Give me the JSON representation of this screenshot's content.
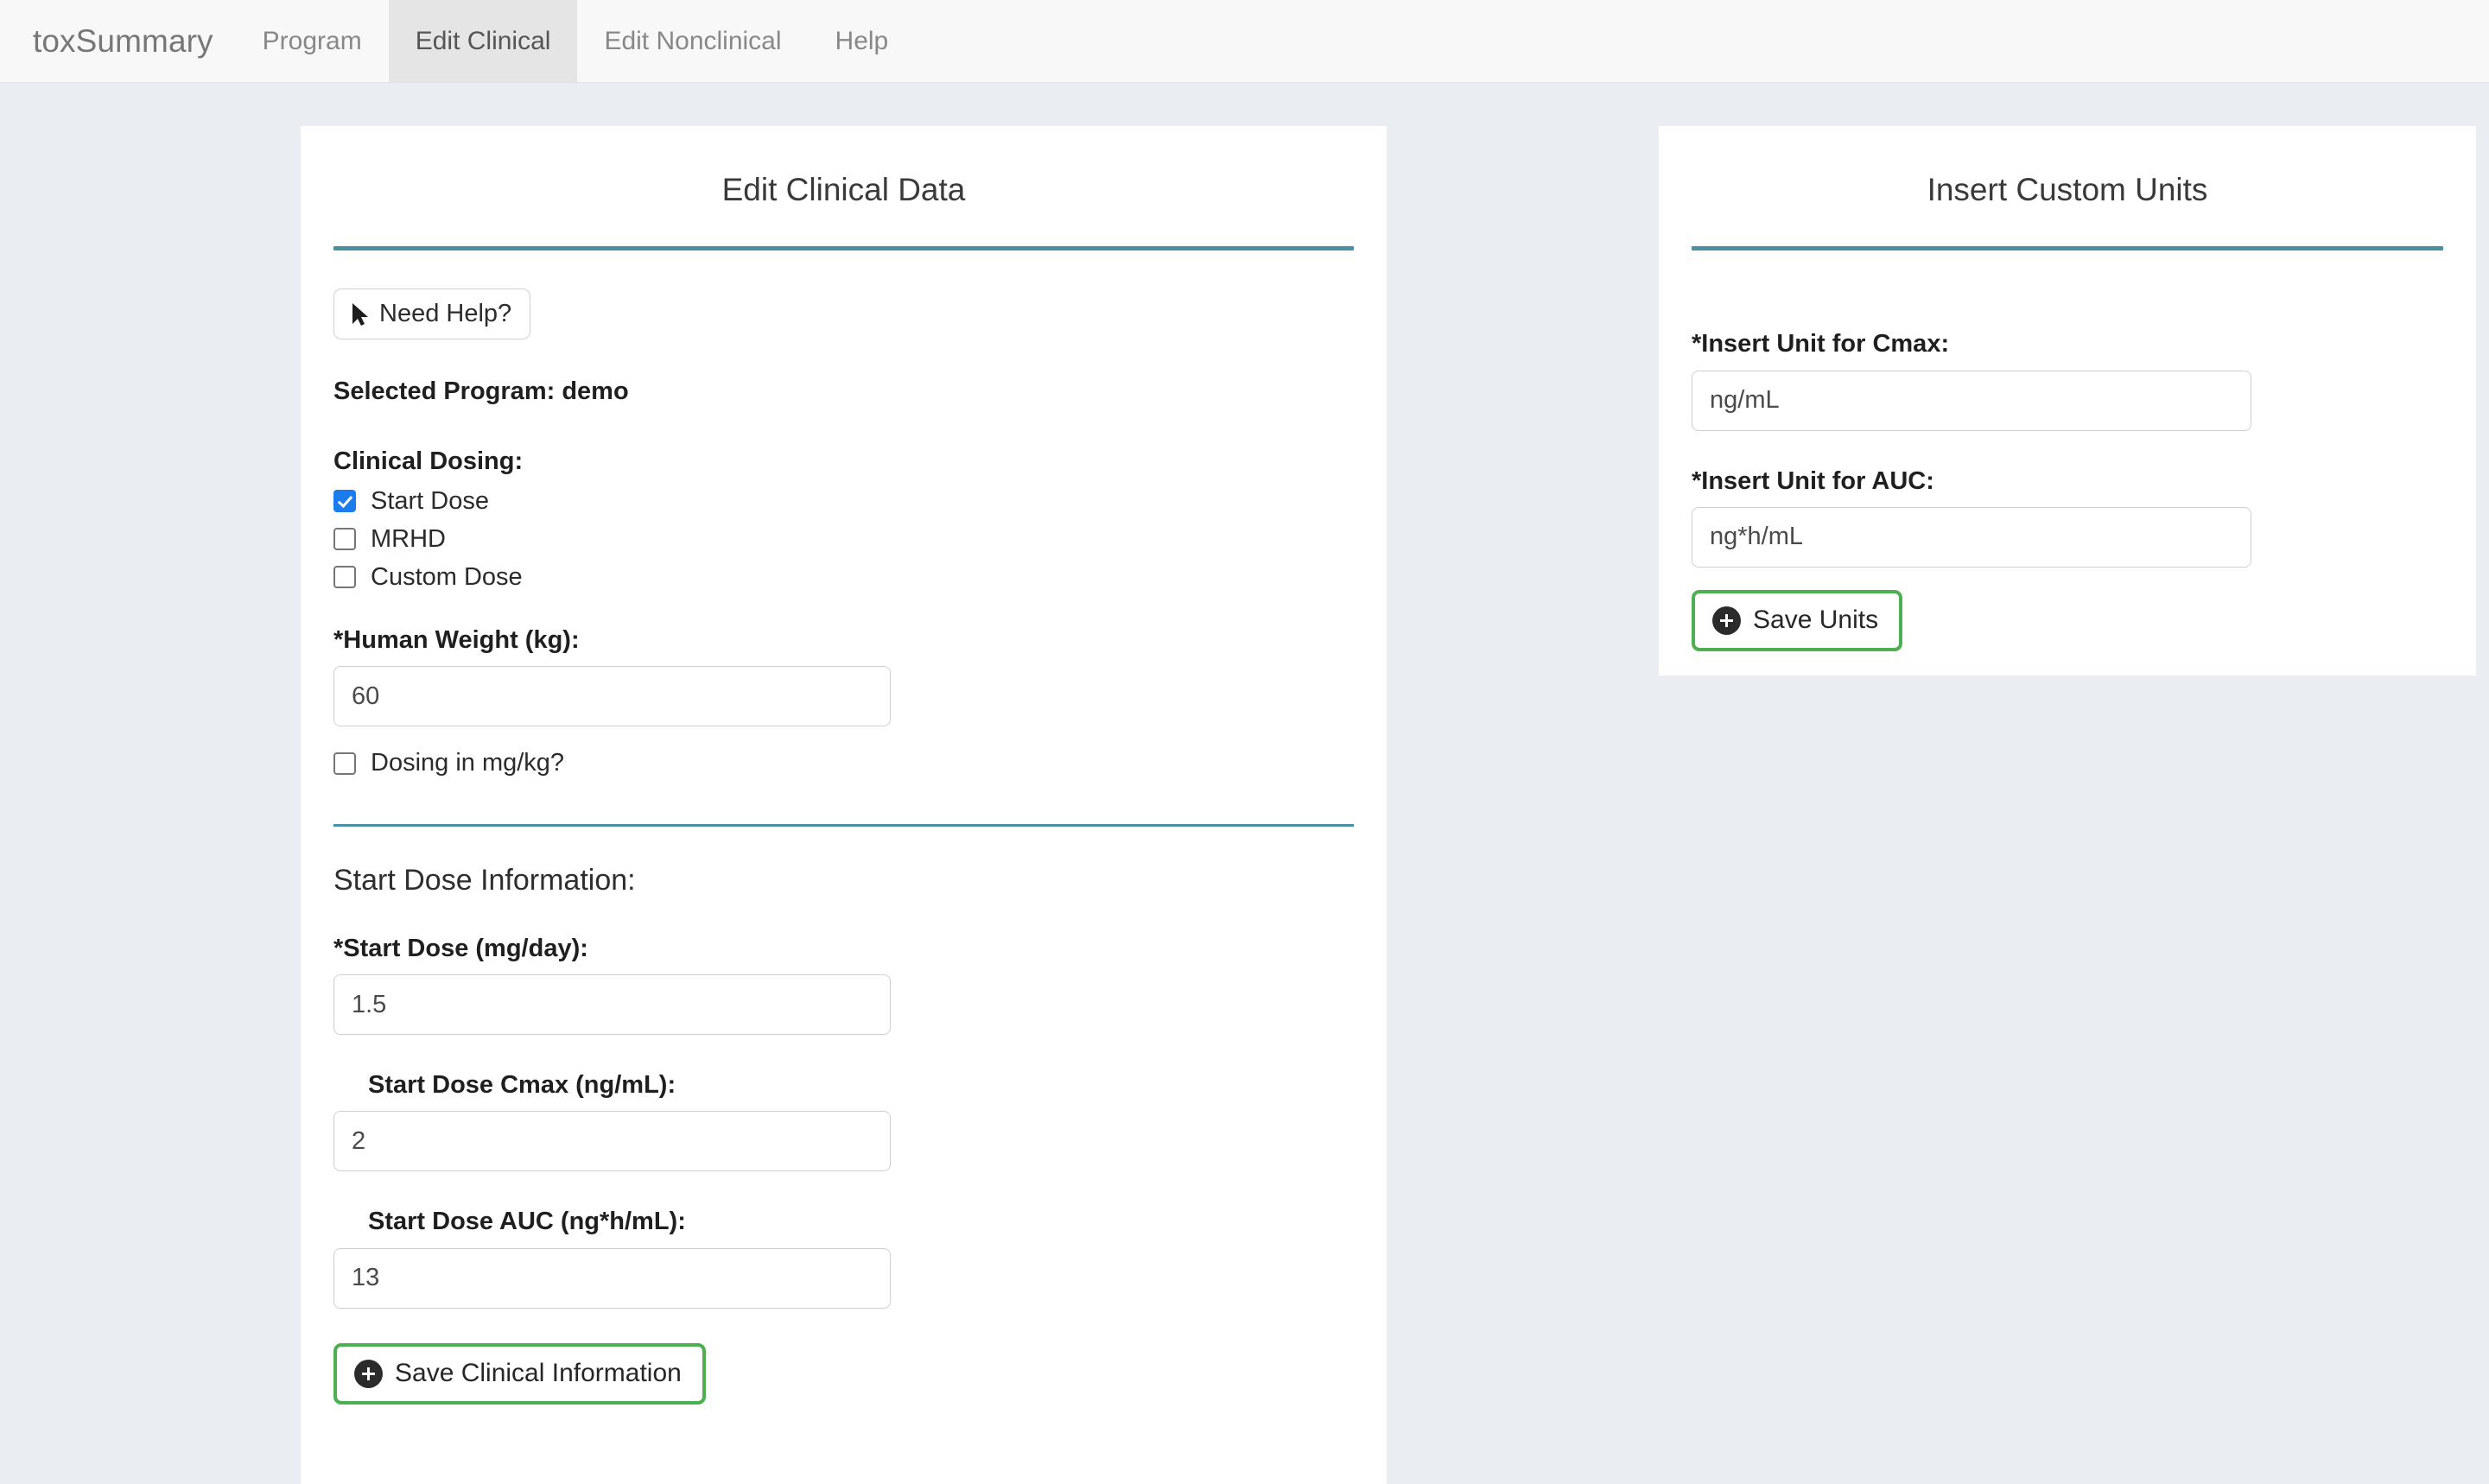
{
  "app": {
    "brand": "toxSummary"
  },
  "nav": {
    "items": [
      {
        "label": "Program",
        "active": false
      },
      {
        "label": "Edit Clinical",
        "active": true
      },
      {
        "label": "Edit Nonclinical",
        "active": false
      },
      {
        "label": "Help",
        "active": false
      }
    ]
  },
  "clinical_card": {
    "title": "Edit Clinical Data",
    "help_button": "Need Help?",
    "selected_program": "Selected Program: demo",
    "dosing_label": "Clinical Dosing:",
    "dosing_options": [
      {
        "label": "Start Dose",
        "checked": true
      },
      {
        "label": "MRHD",
        "checked": false
      },
      {
        "label": "Custom Dose",
        "checked": false
      }
    ],
    "human_weight_label": "*Human Weight (kg):",
    "human_weight_value": "60",
    "mgkg_checkbox_label": "Dosing in mg/kg?",
    "mgkg_checked": false,
    "section_heading": "Start Dose Information:",
    "start_dose_label": "*Start Dose (mg/day):",
    "start_dose_value": "1.5",
    "start_cmax_label": "Start Dose Cmax (ng/mL):",
    "start_cmax_value": "2",
    "start_auc_label": "Start Dose AUC (ng*h/mL):",
    "start_auc_value": "13",
    "save_button": "Save Clinical Information"
  },
  "units_card": {
    "title": "Insert Custom Units",
    "cmax_label": "*Insert Unit for Cmax:",
    "cmax_value": "ng/mL",
    "auc_label": "*Insert Unit for AUC:",
    "auc_value": "ng*h/mL",
    "save_button": "Save Units"
  },
  "colors": {
    "page_background": "#eaedf1",
    "navbar_background": "#f8f8f8",
    "navbar_active_tab": "#e5e5e5",
    "card_background": "#ffffff",
    "accent_rule": "#4a90a4",
    "checkbox_checked": "#1b7ded",
    "save_button_border": "#4caf50",
    "icon_circle": "#2b2b2b"
  }
}
